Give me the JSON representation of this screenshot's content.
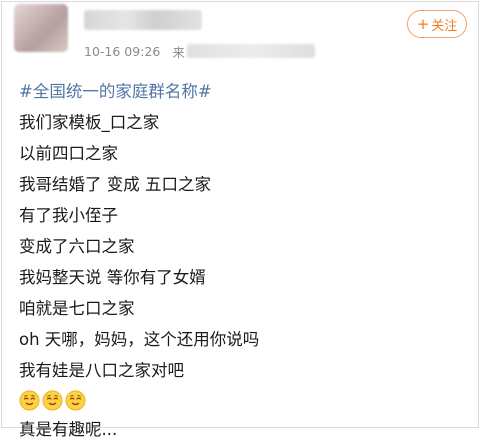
{
  "post": {
    "timestamp": "10-16 09:26",
    "source_prefix": "来",
    "follow_label": "关注",
    "follow_icon": "plus-icon",
    "accent_color": "#f07f22",
    "hashtag_color": "#5176a6",
    "lines": [
      "#全国统一的家庭群名称#",
      "我们家模板_口之家",
      "以前四口之家",
      "我哥结婚了  变成  五口之家",
      "有了我小侄子",
      "变成了六口之家",
      "我妈整天说  等你有了女婿",
      "咱就是七口之家",
      "oh 天哪，妈妈，这个还用你说吗",
      "我有娃是八口之家对吧"
    ],
    "emoji_name": "relieved-face-icon",
    "emoji_count": 3,
    "last_line": "真是有趣呢..."
  }
}
